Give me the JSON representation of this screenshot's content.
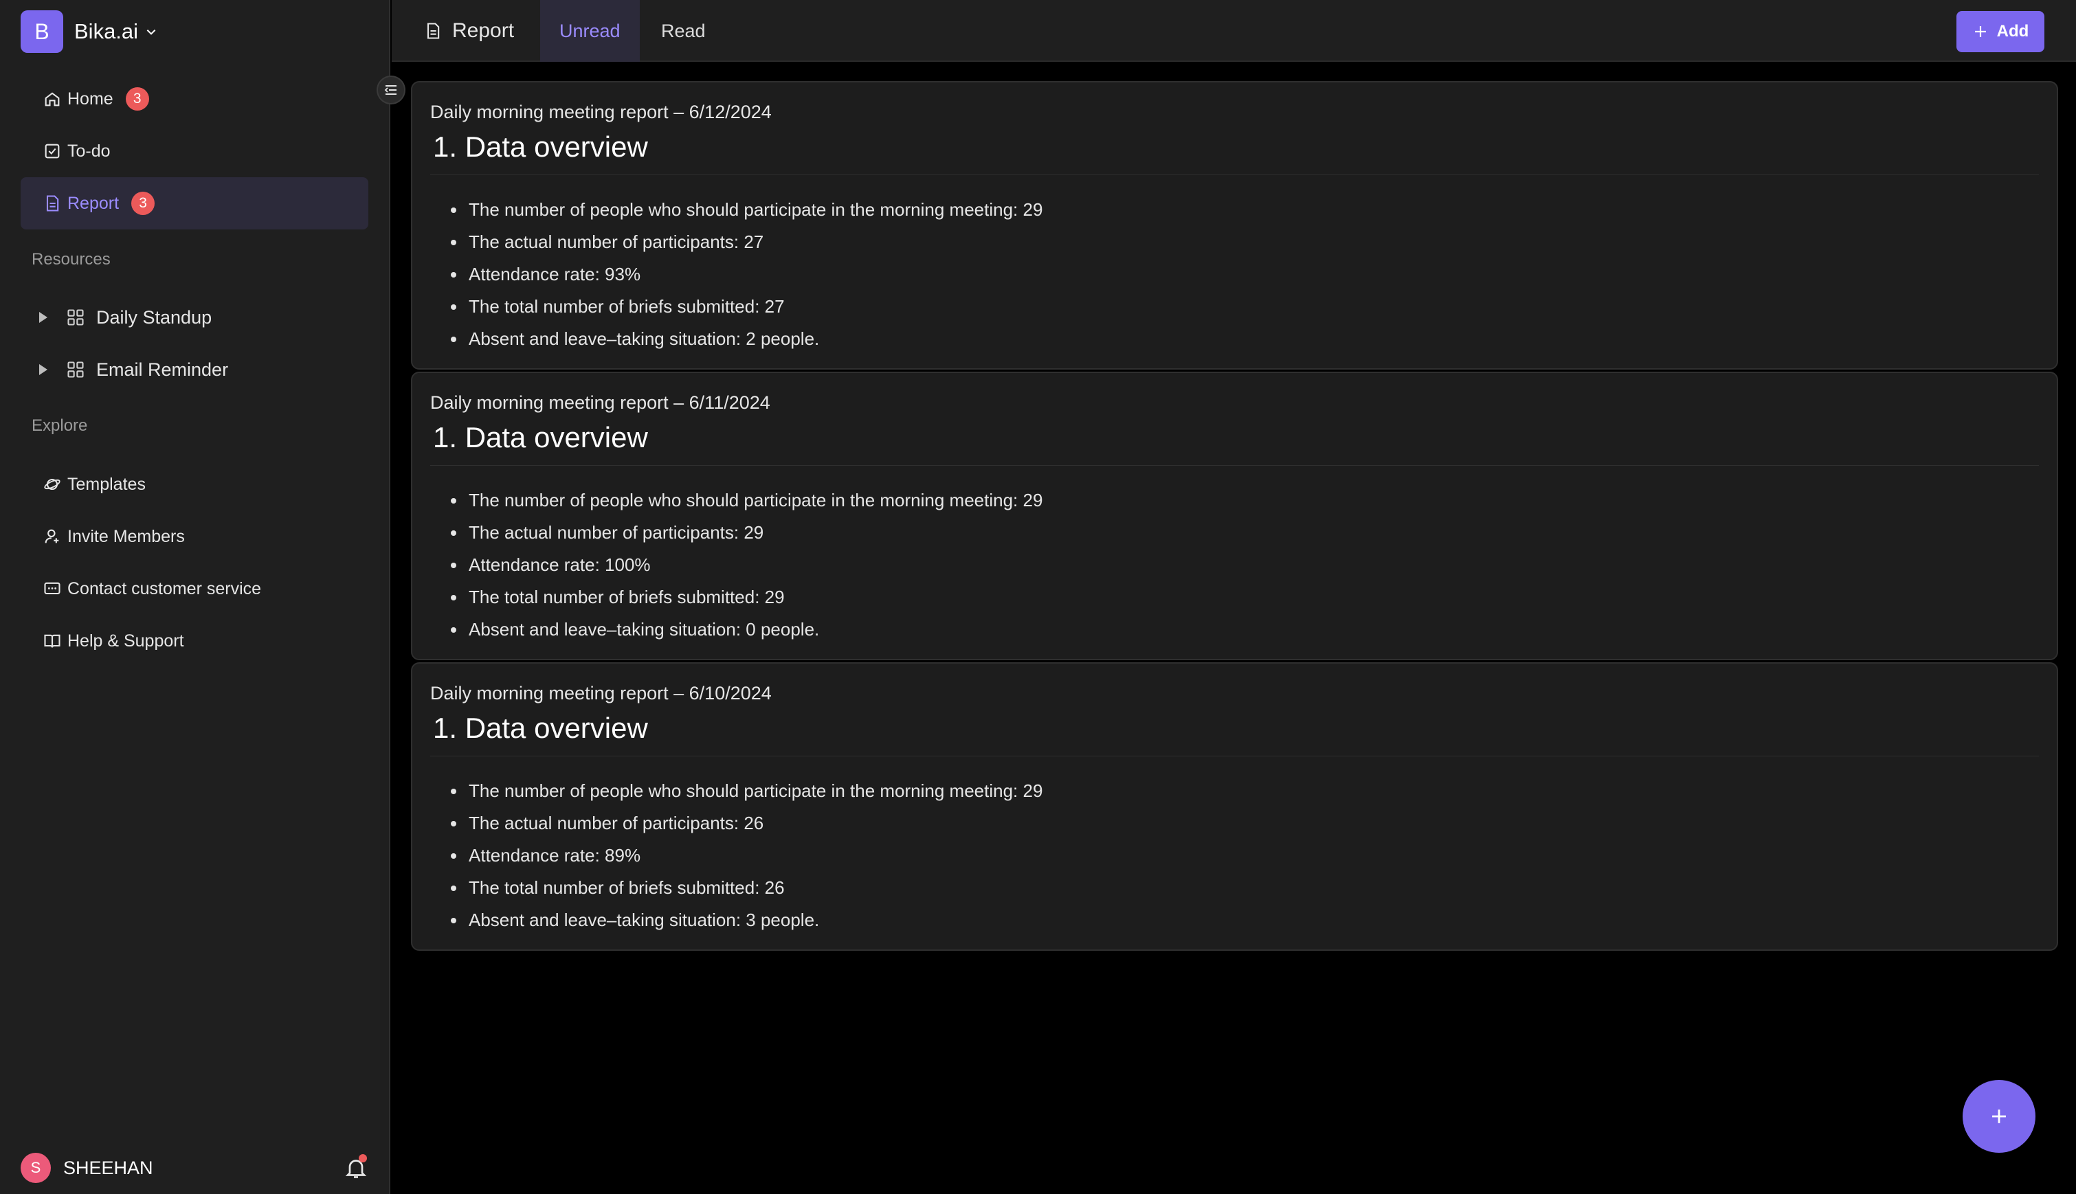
{
  "workspace": {
    "logo_letter": "B",
    "name": "Bika.ai"
  },
  "nav": {
    "home": {
      "label": "Home",
      "badge": "3"
    },
    "todo": {
      "label": "To-do"
    },
    "report": {
      "label": "Report",
      "badge": "3"
    }
  },
  "resources": {
    "label": "Resources",
    "items": [
      {
        "label": "Daily Standup"
      },
      {
        "label": "Email Reminder"
      }
    ]
  },
  "explore": {
    "label": "Explore",
    "items": [
      {
        "label": "Templates",
        "icon": "planet-icon"
      },
      {
        "label": "Invite Members",
        "icon": "user-plus-icon"
      },
      {
        "label": "Contact customer service",
        "icon": "chat-icon"
      },
      {
        "label": "Help & Support",
        "icon": "book-icon"
      }
    ]
  },
  "user": {
    "initial": "S",
    "name": "SHEEHAN"
  },
  "header": {
    "title": "Report",
    "tabs": [
      {
        "label": "Unread"
      },
      {
        "label": "Read"
      }
    ],
    "add_label": "Add"
  },
  "reports": [
    {
      "title": "Daily morning meeting report – 6/12/2024",
      "heading": "1. Data overview",
      "items": [
        "The number of people who should participate in the morning meeting: 29",
        "The actual number of participants: 27",
        "Attendance rate: 93%",
        "The total number of briefs submitted: 27",
        "Absent and leave–taking situation: 2 people."
      ]
    },
    {
      "title": "Daily morning meeting report – 6/11/2024",
      "heading": "1. Data overview",
      "items": [
        "The number of people who should participate in the morning meeting: 29",
        "The actual number of participants: 29",
        "Attendance rate: 100%",
        "The total number of briefs submitted: 29",
        "Absent and leave–taking situation: 0 people."
      ]
    },
    {
      "title": "Daily morning meeting report – 6/10/2024",
      "heading": "1. Data overview",
      "items": [
        "The number of people who should participate in the morning meeting: 29",
        "The actual number of participants: 26",
        "Attendance rate: 89%",
        "The total number of briefs submitted: 26",
        "Absent and leave–taking situation: 3 people."
      ]
    }
  ],
  "colors": {
    "accent": "#7b67ee",
    "badge": "#ec5a5a",
    "sidebar_bg": "#1f1f1f",
    "card_bg": "#1d1d1d"
  }
}
